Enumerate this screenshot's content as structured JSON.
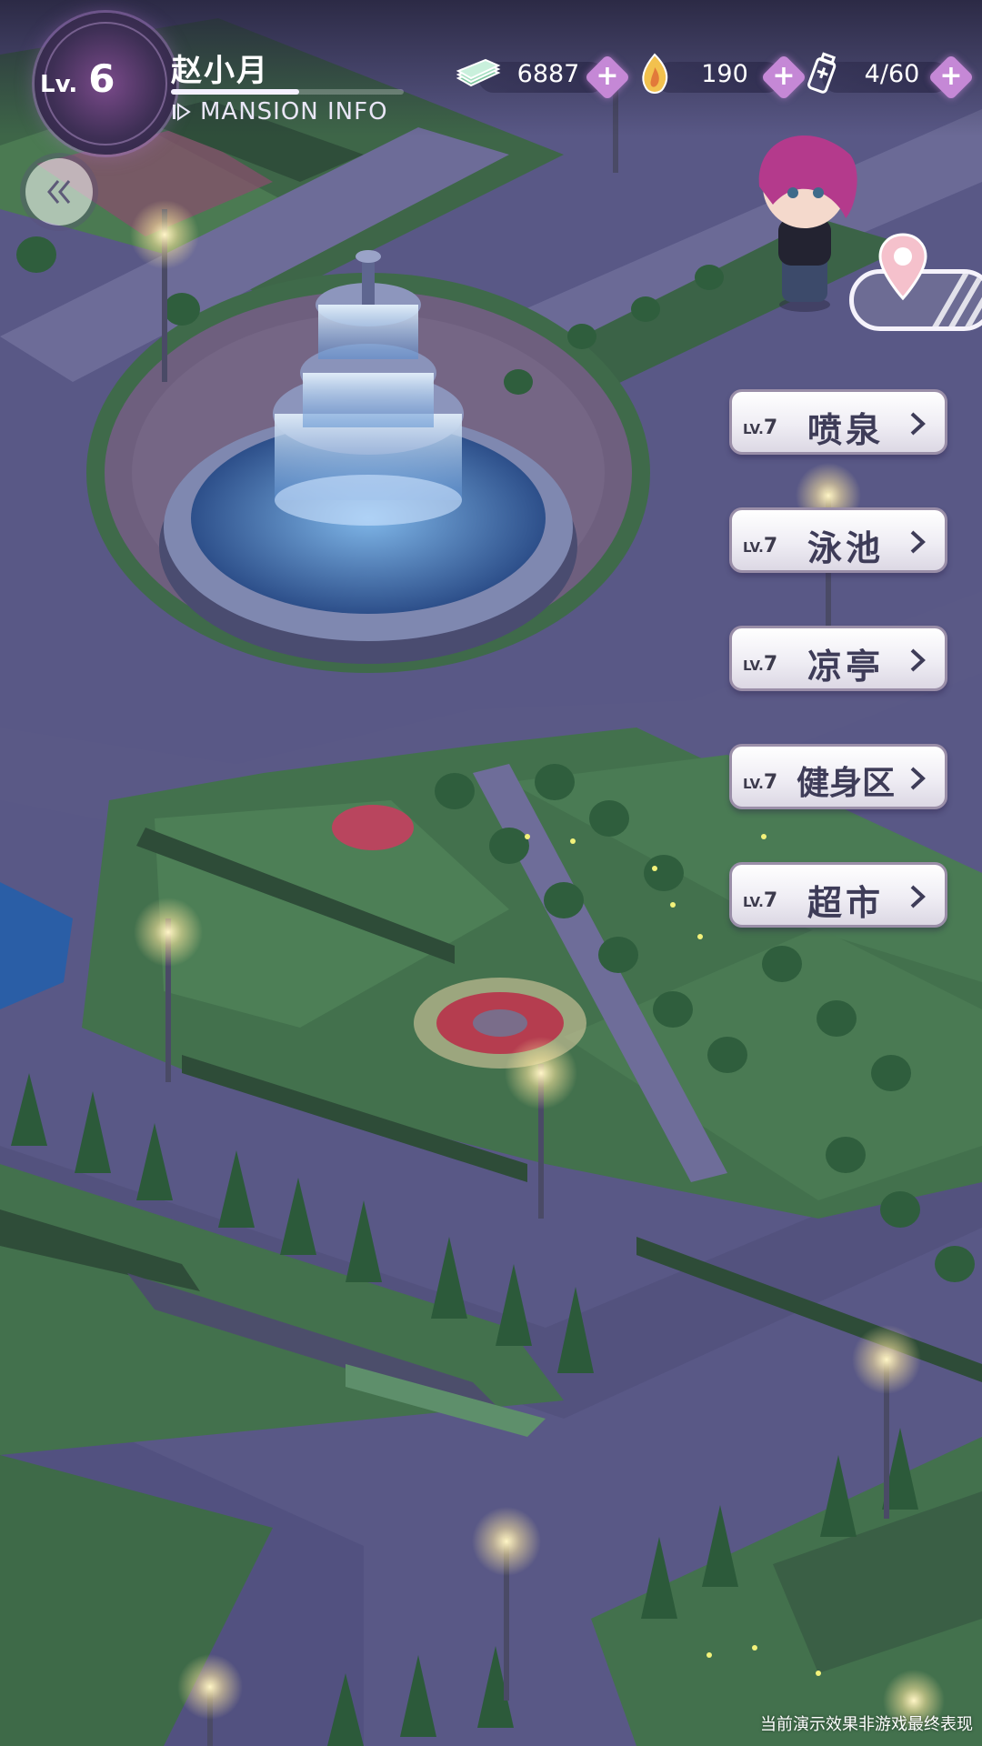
{
  "player": {
    "level_prefix": "Lv.",
    "level": "6",
    "name": "赵小月",
    "xp_progress": 0.55,
    "info_link": "MANSION INFO"
  },
  "currencies": [
    {
      "icon": "cash-icon",
      "value": "6887"
    },
    {
      "icon": "flame-gem-icon",
      "value": "190"
    },
    {
      "icon": "energy-drink-icon",
      "value": "4/60"
    }
  ],
  "facilities": [
    {
      "level_prefix": "LV.",
      "level": "7",
      "name": "喷泉"
    },
    {
      "level_prefix": "LV.",
      "level": "7",
      "name": "泳池"
    },
    {
      "level_prefix": "LV.",
      "level": "7",
      "name": "凉亭"
    },
    {
      "level_prefix": "LV.",
      "level": "7",
      "name": "健身区"
    },
    {
      "level_prefix": "LV.",
      "level": "7",
      "name": "超市"
    }
  ],
  "disclaimer": "当前演示效果非游戏最终表现",
  "colors": {
    "accent": "#c588d6",
    "button_text": "#3e3c58",
    "ground": "#5b5a86",
    "lawn": "#3f6a4a"
  }
}
